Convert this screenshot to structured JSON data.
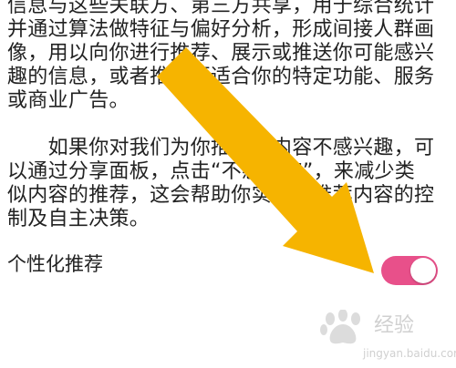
{
  "paragraph1": {
    "lines": [
      "信息与这些关联方、第三方共享，用于综合统计",
      "并通过算法做特征与偏好分析，形成间接人群画",
      "像，用以向你进行推荐、展示或推送你可能感兴",
      "趣的信息，或者推送更适合你的特定功能、服务",
      "或商业广告。"
    ]
  },
  "paragraph2": {
    "lines": [
      "　　如果你对我们为你推荐的内容不感兴趣，可",
      "以通过分享面板，点击“不感兴趣”，来减少类",
      "似内容的推荐，这会帮助你实现对推荐内容的控",
      "制及自主决策。"
    ]
  },
  "setting": {
    "label": "个性化推荐",
    "toggle_on": true,
    "toggle_color": "#e8508a"
  },
  "overlay": {
    "arrow_color": "#f6b400"
  },
  "watermark": {
    "text": "经验",
    "url": "jingyan.baidu.com"
  }
}
